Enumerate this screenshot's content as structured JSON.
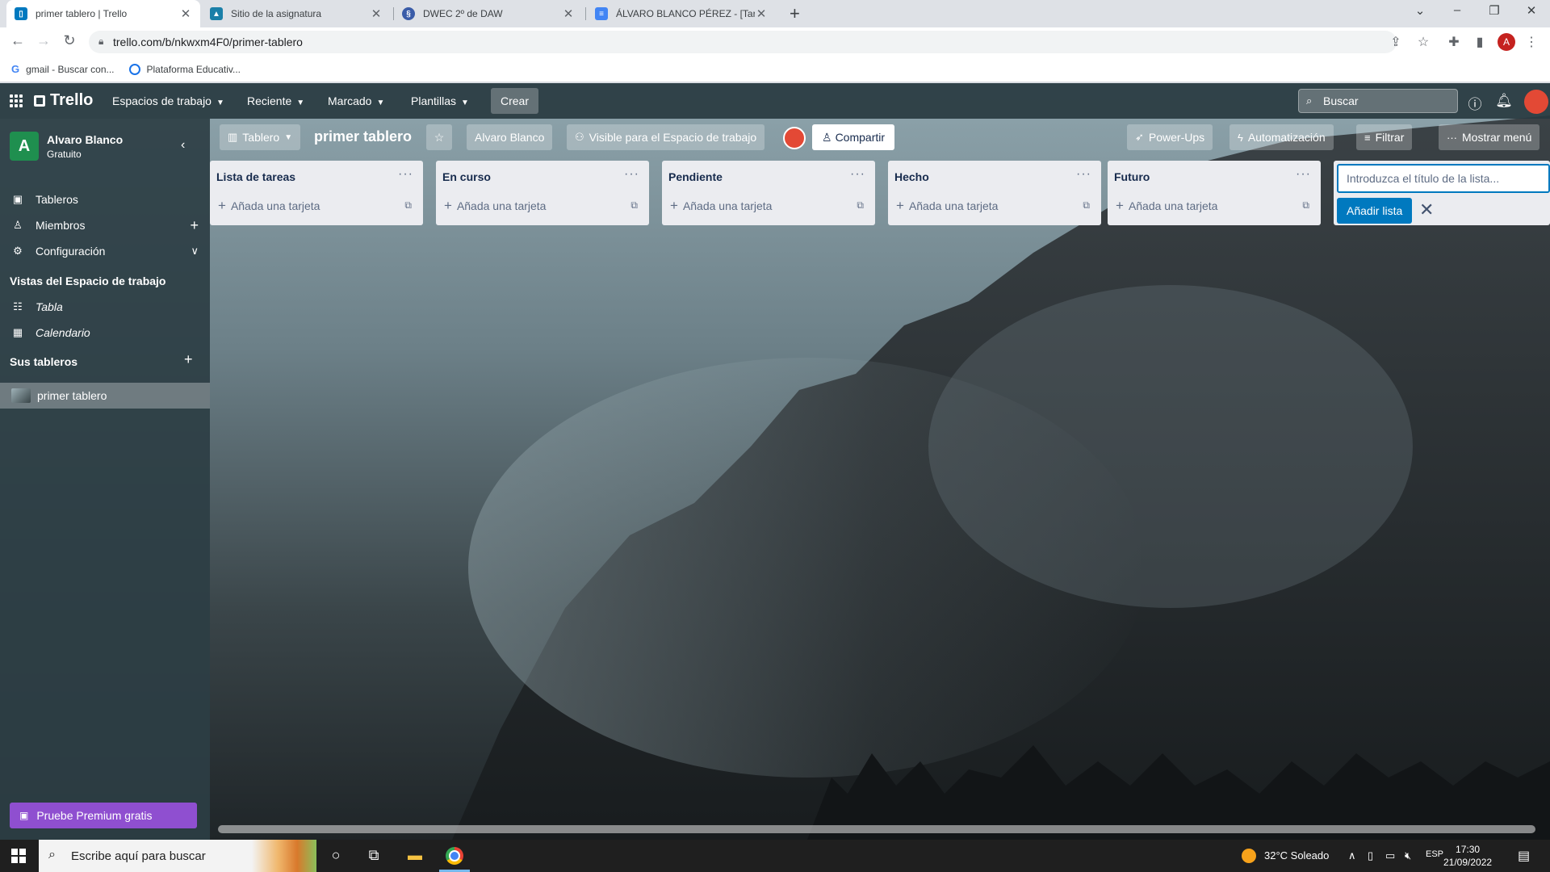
{
  "browser": {
    "tabs": [
      {
        "title": "primer tablero | Trello",
        "active": true,
        "favicon_color": "#0079bf"
      },
      {
        "title": "Sitio de la asignatura",
        "active": false,
        "favicon_color": "#1a7fa8"
      },
      {
        "title": "DWEC 2º de DAW",
        "active": false,
        "favicon_color": "#3a5ca8"
      },
      {
        "title": "ÁLVARO BLANCO PÉREZ - [Tarea]",
        "active": false,
        "favicon_color": "#4285f4"
      }
    ],
    "url": "trello.com/b/nkwxm4F0/primer-tablero",
    "profile_initial": "A",
    "bookmarks": [
      {
        "label": "gmail - Buscar con..."
      },
      {
        "label": "Plataforma Educativ..."
      }
    ]
  },
  "header": {
    "logo": "Trello",
    "nav": [
      "Espacios de trabajo",
      "Reciente",
      "Marcado",
      "Plantillas"
    ],
    "create": "Crear",
    "search_placeholder": "Buscar"
  },
  "sidebar": {
    "workspace_initial": "A",
    "workspace_name": "Alvaro Blanco",
    "workspace_plan": "Gratuito",
    "items": [
      {
        "label": "Tableros",
        "icon": "board-icon"
      },
      {
        "label": "Miembros",
        "icon": "person-icon"
      },
      {
        "label": "Configuración",
        "icon": "gear-icon"
      }
    ],
    "views_heading": "Vistas del Espacio de trabajo",
    "views": [
      {
        "label": "Tabla",
        "icon": "table-icon"
      },
      {
        "label": "Calendario",
        "icon": "calendar-icon"
      }
    ],
    "boards_heading": "Sus tableros",
    "boards": [
      {
        "label": "primer tablero"
      }
    ],
    "premium": "Pruebe Premium gratis"
  },
  "board": {
    "view": "Tablero",
    "title": "primer tablero",
    "workspace": "Alvaro Blanco",
    "visibility": "Visible para el Espacio de trabajo",
    "share": "Compartir",
    "powerups": "Power-Ups",
    "automation": "Automatización",
    "filter": "Filtrar",
    "menu": "Mostrar menú"
  },
  "lists": [
    {
      "title": "Lista de tareas",
      "add_card": "Añada una tarjeta"
    },
    {
      "title": "En curso",
      "add_card": "Añada una tarjeta"
    },
    {
      "title": "Pendiente",
      "add_card": "Añada una tarjeta"
    },
    {
      "title": "Hecho",
      "add_card": "Añada una tarjeta"
    },
    {
      "title": "Futuro",
      "add_card": "Añada una tarjeta"
    }
  ],
  "new_list": {
    "placeholder": "Introduzca el título de la lista...",
    "add_button": "Añadir lista"
  },
  "taskbar": {
    "search_placeholder": "Escribe aquí para buscar",
    "weather": "32°C  Soleado",
    "lang": "ESP",
    "time": "17:30",
    "date": "21/09/2022"
  },
  "colors": {
    "trello_blue": "#0079bf",
    "premium": "#8f4fd0",
    "workspace_avatar": "#1f8f4f"
  }
}
